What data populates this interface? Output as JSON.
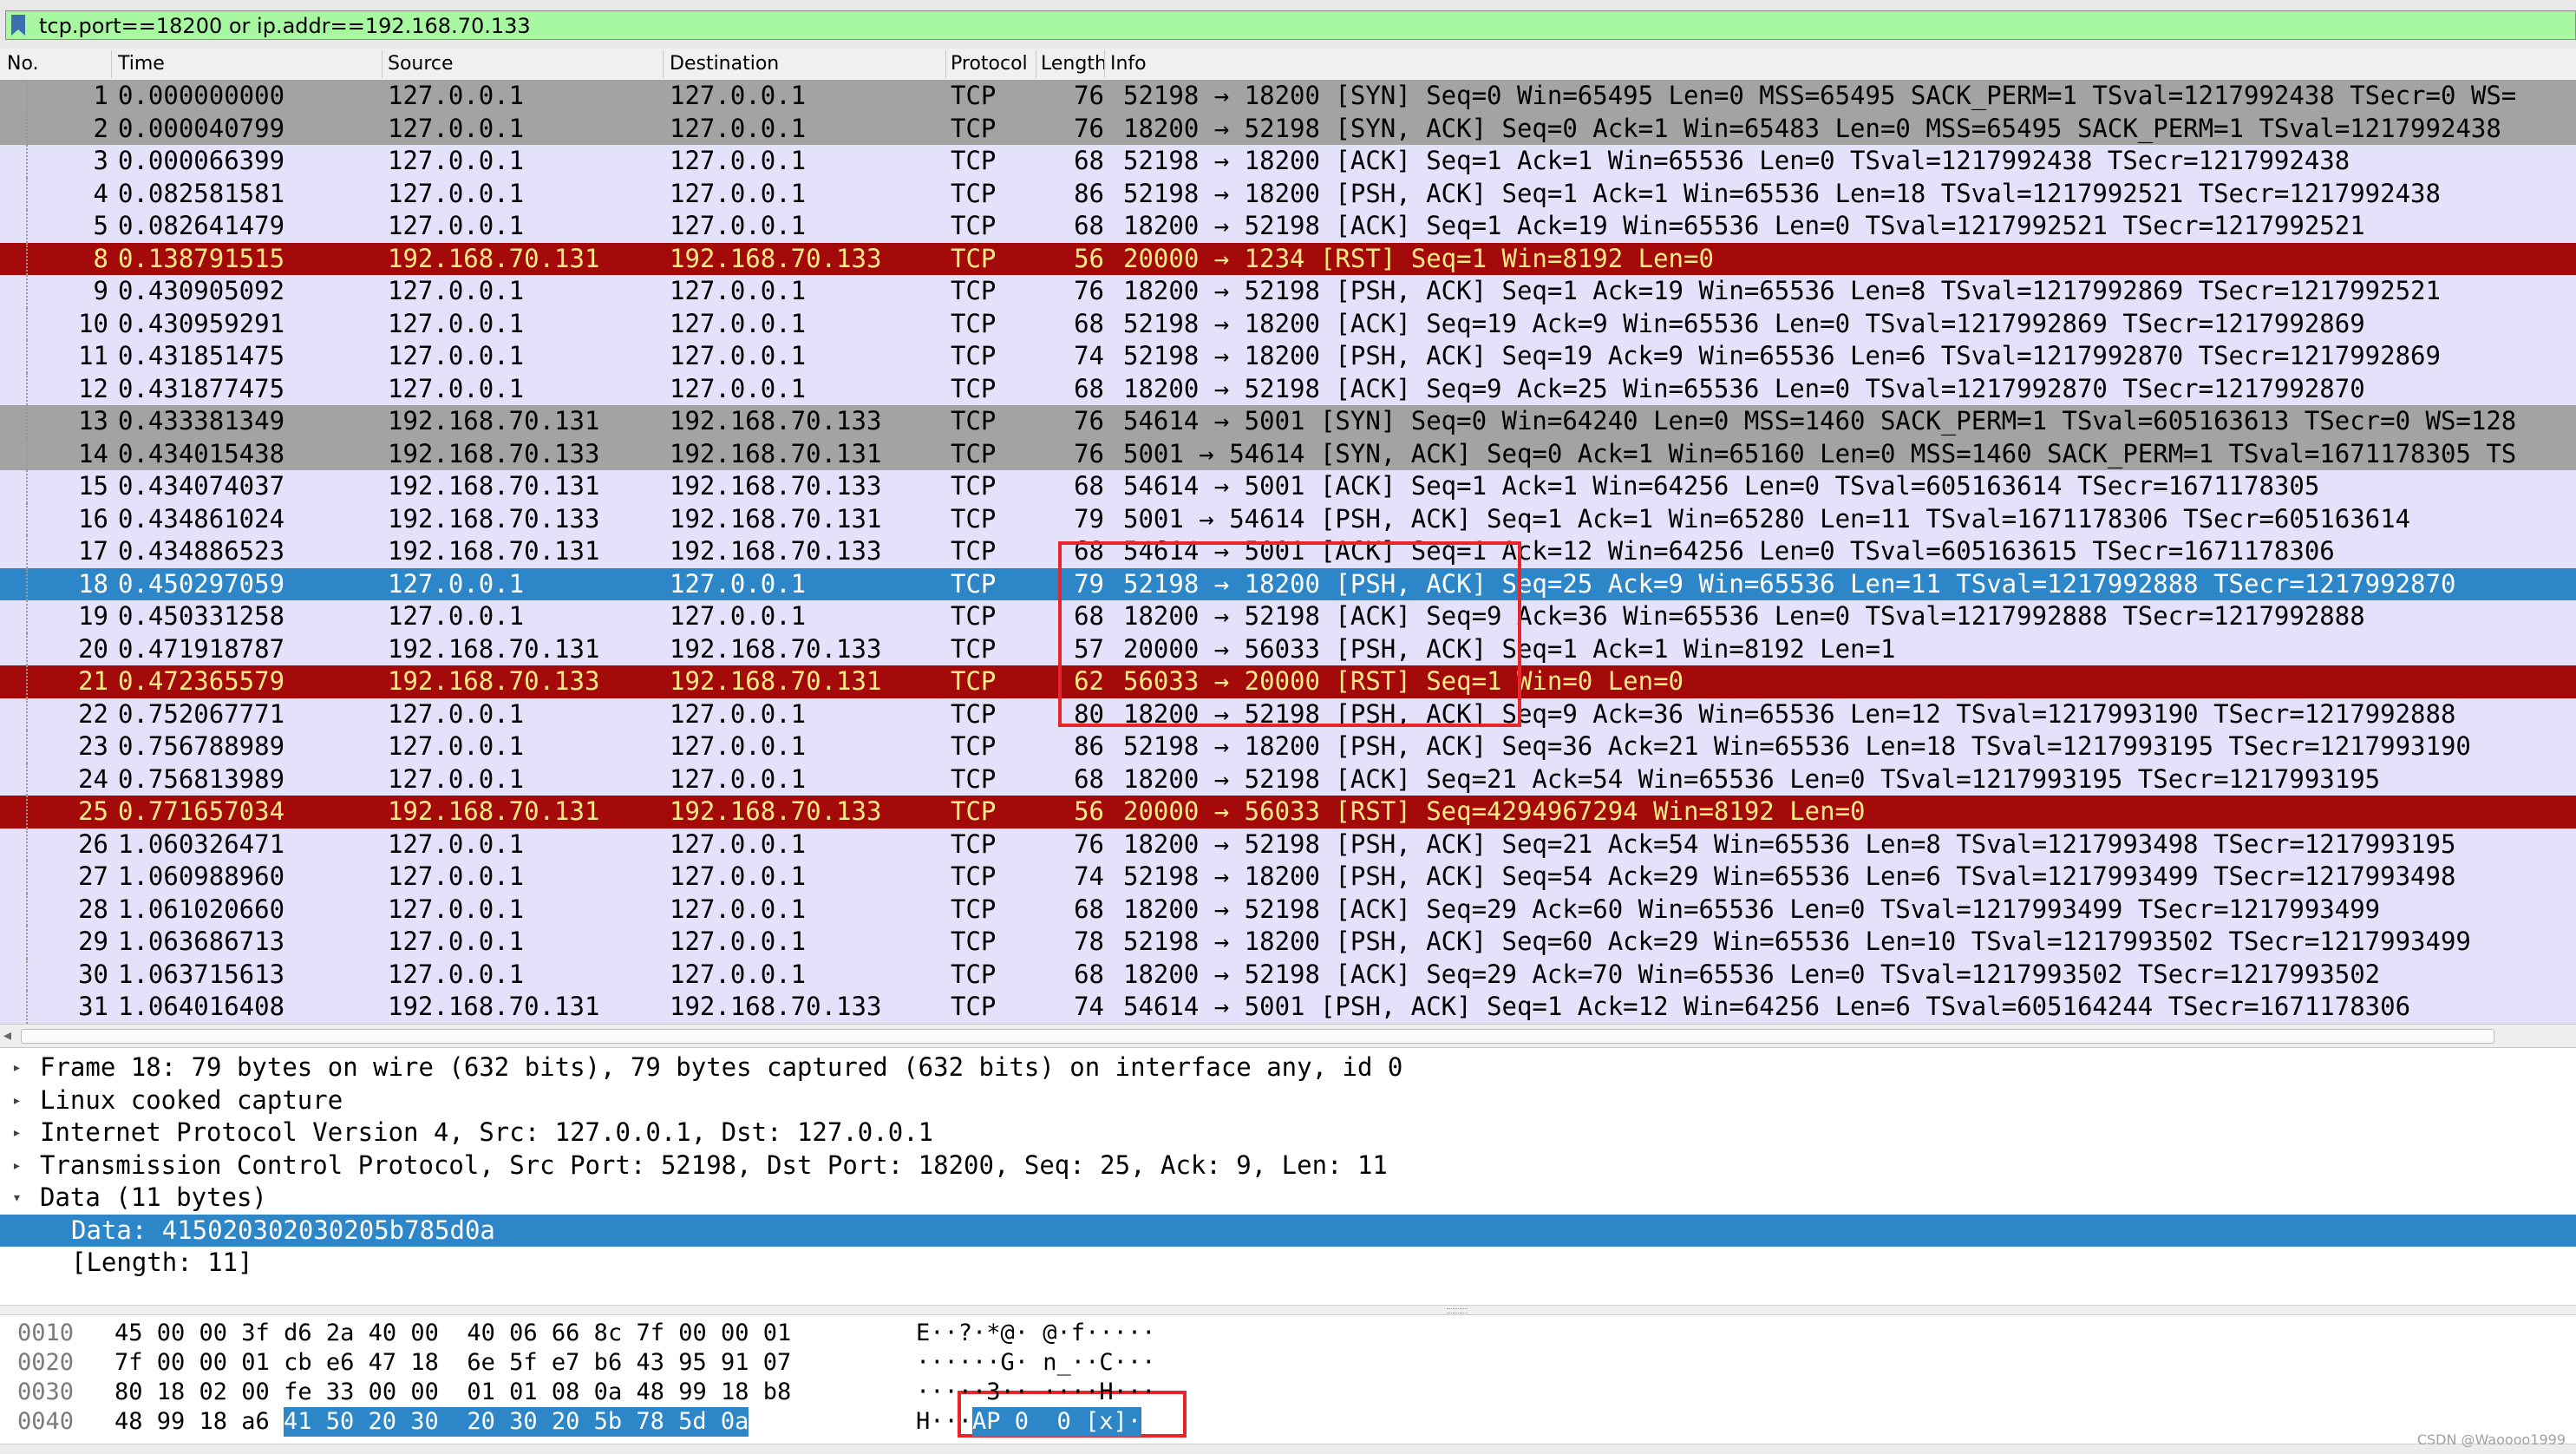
{
  "filter": {
    "text": "tcp.port==18200 or ip.addr==192.168.70.133"
  },
  "columns": {
    "no": "No.",
    "time": "Time",
    "source": "Source",
    "destination": "Destination",
    "protocol": "Protocol",
    "length": "Length",
    "info": "Info"
  },
  "colors": {
    "gray": "#a3a3a3",
    "lavender": "#e4e2fb",
    "red": "#a50a0a",
    "selected": "#2d86c8",
    "filter_green": "#a7f8a0",
    "annotation_red": "#e8262a"
  },
  "packets": [
    {
      "no": "1",
      "time": "0.000000000",
      "src": "127.0.0.1",
      "dst": "127.0.0.1",
      "proto": "TCP",
      "len": "76",
      "info": "52198 → 18200 [SYN] Seq=0 Win=65495 Len=0 MSS=65495 SACK_PERM=1 TSval=1217992438 TSecr=0 WS=",
      "style": "gray"
    },
    {
      "no": "2",
      "time": "0.000040799",
      "src": "127.0.0.1",
      "dst": "127.0.0.1",
      "proto": "TCP",
      "len": "76",
      "info": "18200 → 52198 [SYN, ACK] Seq=0 Ack=1 Win=65483 Len=0 MSS=65495 SACK_PERM=1 TSval=1217992438",
      "style": "gray"
    },
    {
      "no": "3",
      "time": "0.000066399",
      "src": "127.0.0.1",
      "dst": "127.0.0.1",
      "proto": "TCP",
      "len": "68",
      "info": "52198 → 18200 [ACK] Seq=1 Ack=1 Win=65536 Len=0 TSval=1217992438 TSecr=1217992438",
      "style": "lavender"
    },
    {
      "no": "4",
      "time": "0.082581581",
      "src": "127.0.0.1",
      "dst": "127.0.0.1",
      "proto": "TCP",
      "len": "86",
      "info": "52198 → 18200 [PSH, ACK] Seq=1 Ack=1 Win=65536 Len=18 TSval=1217992521 TSecr=1217992438",
      "style": "lavender"
    },
    {
      "no": "5",
      "time": "0.082641479",
      "src": "127.0.0.1",
      "dst": "127.0.0.1",
      "proto": "TCP",
      "len": "68",
      "info": "18200 → 52198 [ACK] Seq=1 Ack=19 Win=65536 Len=0 TSval=1217992521 TSecr=1217992521",
      "style": "lavender"
    },
    {
      "no": "8",
      "time": "0.138791515",
      "src": "192.168.70.131",
      "dst": "192.168.70.133",
      "proto": "TCP",
      "len": "56",
      "info": "20000 → 1234 [RST] Seq=1 Win=8192 Len=0",
      "style": "red"
    },
    {
      "no": "9",
      "time": "0.430905092",
      "src": "127.0.0.1",
      "dst": "127.0.0.1",
      "proto": "TCP",
      "len": "76",
      "info": "18200 → 52198 [PSH, ACK] Seq=1 Ack=19 Win=65536 Len=8 TSval=1217992869 TSecr=1217992521",
      "style": "lavender"
    },
    {
      "no": "10",
      "time": "0.430959291",
      "src": "127.0.0.1",
      "dst": "127.0.0.1",
      "proto": "TCP",
      "len": "68",
      "info": "52198 → 18200 [ACK] Seq=19 Ack=9 Win=65536 Len=0 TSval=1217992869 TSecr=1217992869",
      "style": "lavender"
    },
    {
      "no": "11",
      "time": "0.431851475",
      "src": "127.0.0.1",
      "dst": "127.0.0.1",
      "proto": "TCP",
      "len": "74",
      "info": "52198 → 18200 [PSH, ACK] Seq=19 Ack=9 Win=65536 Len=6 TSval=1217992870 TSecr=1217992869",
      "style": "lavender"
    },
    {
      "no": "12",
      "time": "0.431877475",
      "src": "127.0.0.1",
      "dst": "127.0.0.1",
      "proto": "TCP",
      "len": "68",
      "info": "18200 → 52198 [ACK] Seq=9 Ack=25 Win=65536 Len=0 TSval=1217992870 TSecr=1217992870",
      "style": "lavender"
    },
    {
      "no": "13",
      "time": "0.433381349",
      "src": "192.168.70.131",
      "dst": "192.168.70.133",
      "proto": "TCP",
      "len": "76",
      "info": "54614 → 5001 [SYN] Seq=0 Win=64240 Len=0 MSS=1460 SACK_PERM=1 TSval=605163613 TSecr=0 WS=128",
      "style": "gray"
    },
    {
      "no": "14",
      "time": "0.434015438",
      "src": "192.168.70.133",
      "dst": "192.168.70.131",
      "proto": "TCP",
      "len": "76",
      "info": "5001 → 54614 [SYN, ACK] Seq=0 Ack=1 Win=65160 Len=0 MSS=1460 SACK_PERM=1 TSval=1671178305 TS",
      "style": "gray"
    },
    {
      "no": "15",
      "time": "0.434074037",
      "src": "192.168.70.131",
      "dst": "192.168.70.133",
      "proto": "TCP",
      "len": "68",
      "info": "54614 → 5001 [ACK] Seq=1 Ack=1 Win=64256 Len=0 TSval=605163614 TSecr=1671178305",
      "style": "lavender"
    },
    {
      "no": "16",
      "time": "0.434861024",
      "src": "192.168.70.133",
      "dst": "192.168.70.131",
      "proto": "TCP",
      "len": "79",
      "info": "5001 → 54614 [PSH, ACK] Seq=1 Ack=1 Win=65280 Len=11 TSval=1671178306 TSecr=605163614",
      "style": "lavender"
    },
    {
      "no": "17",
      "time": "0.434886523",
      "src": "192.168.70.131",
      "dst": "192.168.70.133",
      "proto": "TCP",
      "len": "68",
      "info": "54614 → 5001 [ACK] Seq=1 Ack=12 Win=64256 Len=0 TSval=605163615 TSecr=1671178306",
      "style": "lavender"
    },
    {
      "no": "18",
      "time": "0.450297059",
      "src": "127.0.0.1",
      "dst": "127.0.0.1",
      "proto": "TCP",
      "len": "79",
      "info": "52198 → 18200 [PSH, ACK] Seq=25 Ack=9 Win=65536 Len=11 TSval=1217992888 TSecr=1217992870",
      "style": "selected"
    },
    {
      "no": "19",
      "time": "0.450331258",
      "src": "127.0.0.1",
      "dst": "127.0.0.1",
      "proto": "TCP",
      "len": "68",
      "info": "18200 → 52198 [ACK] Seq=9 Ack=36 Win=65536 Len=0 TSval=1217992888 TSecr=1217992888",
      "style": "lavender"
    },
    {
      "no": "20",
      "time": "0.471918787",
      "src": "192.168.70.131",
      "dst": "192.168.70.133",
      "proto": "TCP",
      "len": "57",
      "info": "20000 → 56033 [PSH, ACK] Seq=1 Ack=1 Win=8192 Len=1",
      "style": "lavender"
    },
    {
      "no": "21",
      "time": "0.472365579",
      "src": "192.168.70.133",
      "dst": "192.168.70.131",
      "proto": "TCP",
      "len": "62",
      "info": "56033 → 20000 [RST] Seq=1 Win=0 Len=0",
      "style": "red"
    },
    {
      "no": "22",
      "time": "0.752067771",
      "src": "127.0.0.1",
      "dst": "127.0.0.1",
      "proto": "TCP",
      "len": "80",
      "info": "18200 → 52198 [PSH, ACK] Seq=9 Ack=36 Win=65536 Len=12 TSval=1217993190 TSecr=1217992888",
      "style": "lavender"
    },
    {
      "no": "23",
      "time": "0.756788989",
      "src": "127.0.0.1",
      "dst": "127.0.0.1",
      "proto": "TCP",
      "len": "86",
      "info": "52198 → 18200 [PSH, ACK] Seq=36 Ack=21 Win=65536 Len=18 TSval=1217993195 TSecr=1217993190",
      "style": "lavender"
    },
    {
      "no": "24",
      "time": "0.756813989",
      "src": "127.0.0.1",
      "dst": "127.0.0.1",
      "proto": "TCP",
      "len": "68",
      "info": "18200 → 52198 [ACK] Seq=21 Ack=54 Win=65536 Len=0 TSval=1217993195 TSecr=1217993195",
      "style": "lavender"
    },
    {
      "no": "25",
      "time": "0.771657034",
      "src": "192.168.70.131",
      "dst": "192.168.70.133",
      "proto": "TCP",
      "len": "56",
      "info": "20000 → 56033 [RST] Seq=4294967294 Win=8192 Len=0",
      "style": "red"
    },
    {
      "no": "26",
      "time": "1.060326471",
      "src": "127.0.0.1",
      "dst": "127.0.0.1",
      "proto": "TCP",
      "len": "76",
      "info": "18200 → 52198 [PSH, ACK] Seq=21 Ack=54 Win=65536 Len=8 TSval=1217993498 TSecr=1217993195",
      "style": "lavender"
    },
    {
      "no": "27",
      "time": "1.060988960",
      "src": "127.0.0.1",
      "dst": "127.0.0.1",
      "proto": "TCP",
      "len": "74",
      "info": "52198 → 18200 [PSH, ACK] Seq=54 Ack=29 Win=65536 Len=6 TSval=1217993499 TSecr=1217993498",
      "style": "lavender"
    },
    {
      "no": "28",
      "time": "1.061020660",
      "src": "127.0.0.1",
      "dst": "127.0.0.1",
      "proto": "TCP",
      "len": "68",
      "info": "18200 → 52198 [ACK] Seq=29 Ack=60 Win=65536 Len=0 TSval=1217993499 TSecr=1217993499",
      "style": "lavender"
    },
    {
      "no": "29",
      "time": "1.063686713",
      "src": "127.0.0.1",
      "dst": "127.0.0.1",
      "proto": "TCP",
      "len": "78",
      "info": "52198 → 18200 [PSH, ACK] Seq=60 Ack=29 Win=65536 Len=10 TSval=1217993502 TSecr=1217993499",
      "style": "lavender"
    },
    {
      "no": "30",
      "time": "1.063715613",
      "src": "127.0.0.1",
      "dst": "127.0.0.1",
      "proto": "TCP",
      "len": "68",
      "info": "18200 → 52198 [ACK] Seq=29 Ack=70 Win=65536 Len=0 TSval=1217993502 TSecr=1217993502",
      "style": "lavender"
    },
    {
      "no": "31",
      "time": "1.064016408",
      "src": "192.168.70.131",
      "dst": "192.168.70.133",
      "proto": "TCP",
      "len": "74",
      "info": "54614 → 5001 [PSH, ACK] Seq=1 Ack=12 Win=64256 Len=6 TSval=605164244 TSecr=1671178306",
      "style": "lavender"
    }
  ],
  "details": [
    {
      "arrow": "▸",
      "indent": 0,
      "text": "Frame 18: 79 bytes on wire (632 bits), 79 bytes captured (632 bits) on interface any, id 0",
      "selected": false
    },
    {
      "arrow": "▸",
      "indent": 0,
      "text": "Linux cooked capture",
      "selected": false
    },
    {
      "arrow": "▸",
      "indent": 0,
      "text": "Internet Protocol Version 4, Src: 127.0.0.1, Dst: 127.0.0.1",
      "selected": false
    },
    {
      "arrow": "▸",
      "indent": 0,
      "text": "Transmission Control Protocol, Src Port: 52198, Dst Port: 18200, Seq: 25, Ack: 9, Len: 11",
      "selected": false
    },
    {
      "arrow": "▾",
      "indent": 0,
      "text": "Data (11 bytes)",
      "selected": false
    },
    {
      "arrow": "",
      "indent": 1,
      "text": "Data: 415020302030205b785d0a",
      "selected": true
    },
    {
      "arrow": "",
      "indent": 1,
      "text": "[Length: 11]",
      "selected": false
    }
  ],
  "bytes": [
    {
      "offset": "0010",
      "hex_plain": "45 00 00 3f d6 2a 40 00  40 06 66 8c 7f 00 00 01",
      "hex_sel": "",
      "ascii_plain": "E··?·*@· @·f·····",
      "ascii_sel": ""
    },
    {
      "offset": "0020",
      "hex_plain": "7f 00 00 01 cb e6 47 18  6e 5f e7 b6 43 95 91 07",
      "hex_sel": "",
      "ascii_plain": "······G· n_··C···",
      "ascii_sel": ""
    },
    {
      "offset": "0030",
      "hex_plain": "80 18 02 00 fe 33 00 00  01 01 08 0a 48 99 18 b8",
      "hex_sel": "",
      "ascii_plain": "·····3·· ····H···",
      "ascii_sel": ""
    },
    {
      "offset": "0040",
      "hex_plain": "48 99 18 a6 ",
      "hex_sel": "41 50 20 30  20 30 20 5b 78 5d 0a",
      "ascii_plain": "H···",
      "ascii_sel": "AP 0  0 [x]·"
    }
  ],
  "watermark": "CSDN @Waoooo1999"
}
